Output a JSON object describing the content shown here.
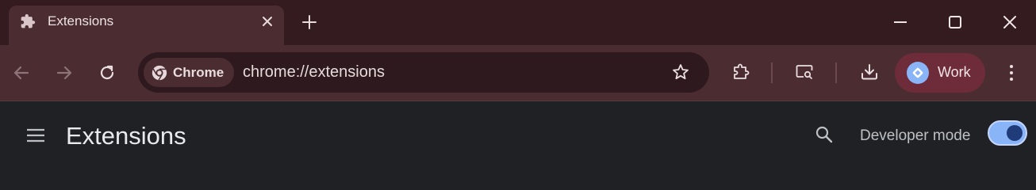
{
  "tab": {
    "title": "Extensions"
  },
  "toolbar": {
    "chip_label": "Chrome",
    "url": "chrome://extensions",
    "profile_label": "Work"
  },
  "page": {
    "title": "Extensions",
    "developer_mode_label": "Developer mode",
    "developer_mode_on": true
  },
  "colors": {
    "tabstrip": "#331b20",
    "toolbar": "#4a2c31",
    "profile": "#6e2c3a",
    "page": "#202124",
    "toggle": "#8ab4f8"
  }
}
